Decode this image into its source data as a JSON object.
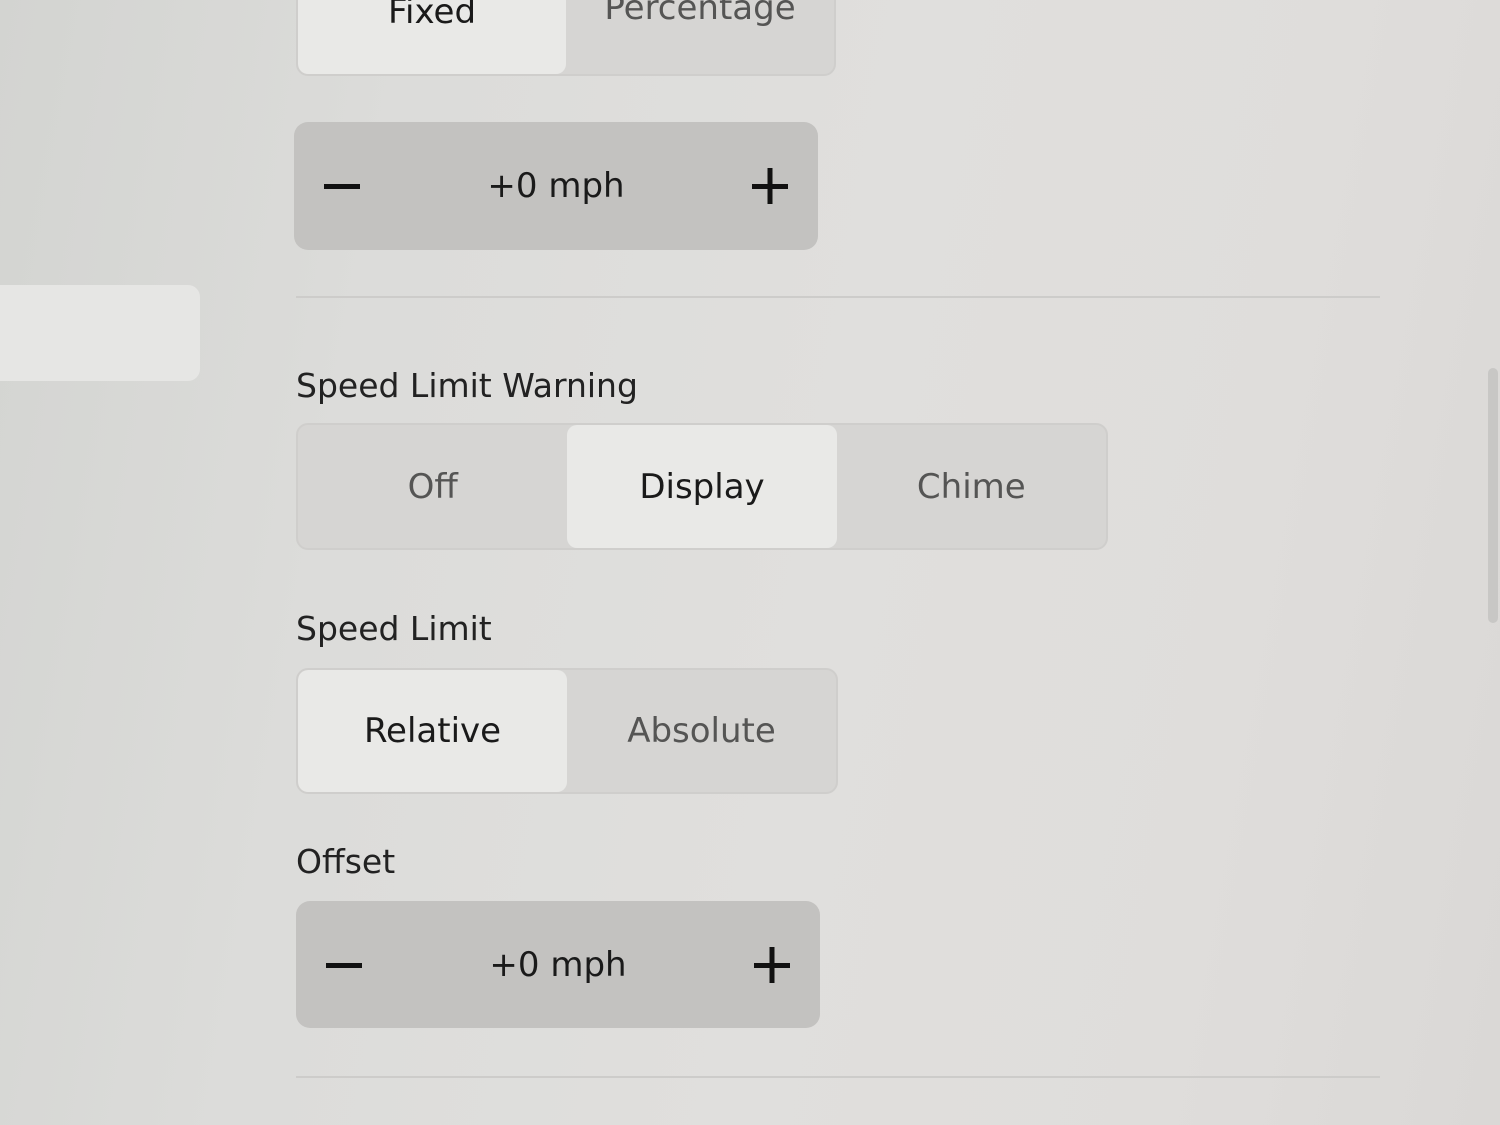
{
  "top_segment": {
    "options": [
      "Fixed",
      "Percentage"
    ],
    "selected": "Fixed"
  },
  "top_stepper": {
    "value": "+0 mph",
    "decrement_icon": "minus-icon",
    "increment_icon": "plus-icon"
  },
  "speed_limit_warning": {
    "label": "Speed Limit Warning",
    "options": [
      "Off",
      "Display",
      "Chime"
    ],
    "selected": "Display"
  },
  "speed_limit": {
    "label": "Speed Limit",
    "options": [
      "Relative",
      "Absolute"
    ],
    "selected": "Relative"
  },
  "offset": {
    "label": "Offset",
    "value": "+0 mph",
    "decrement_icon": "minus-icon",
    "increment_icon": "plus-icon"
  }
}
